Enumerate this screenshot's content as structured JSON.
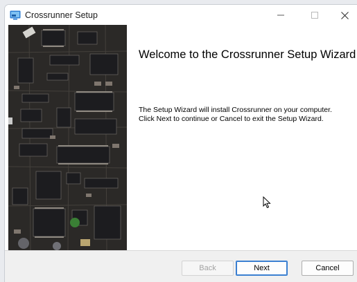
{
  "window": {
    "title": "Crossrunner Setup",
    "controls": {
      "minimize_icon": "minimize-icon",
      "maximize_icon": "maximize-icon",
      "close_icon": "close-icon"
    }
  },
  "banner": {
    "image": "circuit-board-image"
  },
  "wizard": {
    "heading": "Welcome to the Crossrunner Setup Wizard",
    "line1": "The Setup Wizard will install Crossrunner on your computer.",
    "line2": "Click Next to continue or Cancel to exit the Setup Wizard."
  },
  "buttons": {
    "back": "Back",
    "next": "Next",
    "cancel": "Cancel"
  },
  "colors": {
    "accent": "#3a7fd1",
    "footer_bg": "#f0f0f0",
    "banner_bg": "#2d2b29"
  }
}
